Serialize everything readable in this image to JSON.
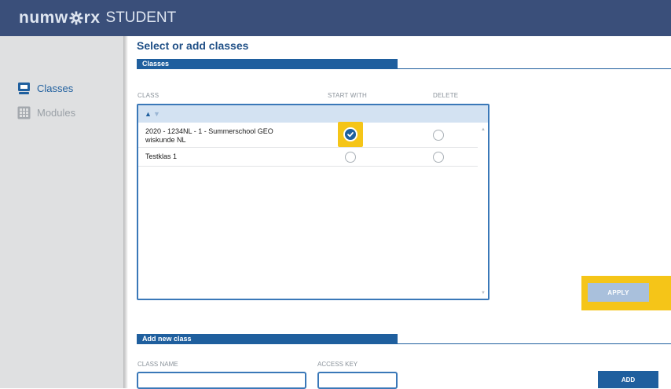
{
  "app": {
    "brand": "numworx",
    "suffix": "STUDENT"
  },
  "sidebar": {
    "items": [
      {
        "label": "Classes",
        "icon": "chalkboard-icon",
        "active": true
      },
      {
        "label": "Modules",
        "icon": "grid-icon",
        "active": false
      }
    ]
  },
  "main": {
    "title": "Select or add classes",
    "classes_section": {
      "label": "Classes",
      "columns": {
        "class": "CLASS",
        "start_with": "START WITH",
        "delete": "DELETE"
      },
      "rows": [
        {
          "name": "2020 - 1234NL - 1 - Summerschool GEO wiskunde NL",
          "start_with": true,
          "delete": false
        },
        {
          "name": "Testklas 1",
          "start_with": false,
          "delete": false
        }
      ],
      "apply_label": "APPLY"
    },
    "add_section": {
      "label": "Add new class",
      "class_name_label": "CLASS NAME",
      "access_key_label": "ACCESS KEY",
      "class_name_value": "",
      "access_key_value": "",
      "add_label": "ADD"
    }
  },
  "colors": {
    "topbar": "#3a4f7a",
    "accent": "#1f5f9e",
    "highlight": "#f5c518",
    "sidebar": "#dfe0e1"
  }
}
